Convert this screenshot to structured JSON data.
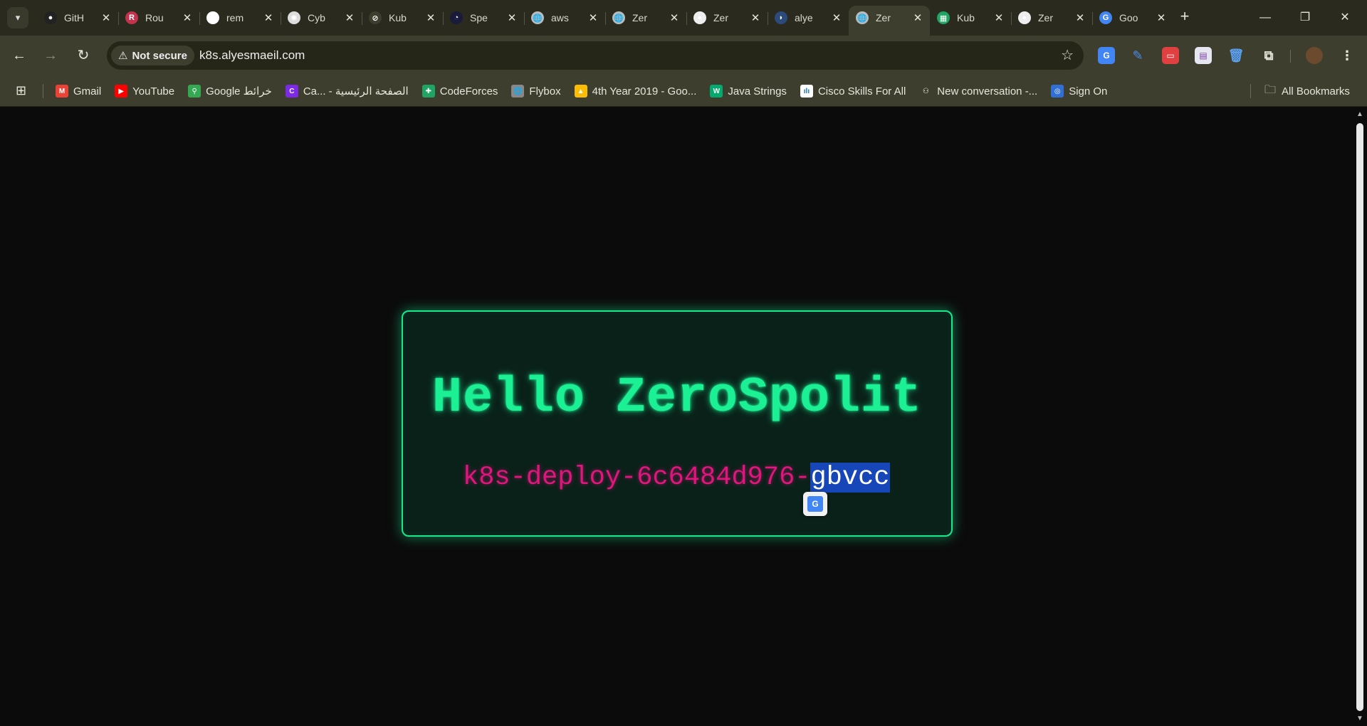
{
  "tabs": [
    {
      "title": "GitH",
      "favicon": "github-icon",
      "color": "#222222",
      "glyph": "●",
      "active": false
    },
    {
      "title": "Rou",
      "favicon": "router-icon",
      "color": "#c2334d",
      "glyph": "R",
      "active": false
    },
    {
      "title": "rem",
      "favicon": "google-icon",
      "color": "#ffffff",
      "glyph": "G",
      "active": false
    },
    {
      "title": "Cyb",
      "favicon": "openai-icon",
      "color": "#dddddd",
      "glyph": "✺",
      "active": false
    },
    {
      "title": "Kub",
      "favicon": "ban-icon",
      "color": "#3e3e2e",
      "glyph": "⊘",
      "active": false
    },
    {
      "title": "Spe",
      "favicon": "speed-icon",
      "color": "#1a1a3a",
      "glyph": "◔",
      "active": false
    },
    {
      "title": "aws",
      "favicon": "globe-icon",
      "color": "#bbbbbb",
      "glyph": "🌐",
      "active": false
    },
    {
      "title": "Zer",
      "favicon": "globe-icon",
      "color": "#bbbbbb",
      "glyph": "🌐",
      "active": false
    },
    {
      "title": "Zer",
      "favicon": "github-icon",
      "color": "#eeeeee",
      "glyph": "●",
      "active": false
    },
    {
      "title": "alye",
      "favicon": "bird-icon",
      "color": "#2c4a7a",
      "glyph": "◗",
      "active": false
    },
    {
      "title": "Zer",
      "favicon": "globe-icon",
      "color": "#bbbbbb",
      "glyph": "🌐",
      "active": true
    },
    {
      "title": "Kub",
      "favicon": "sheets-icon",
      "color": "#1fa463",
      "glyph": "▦",
      "active": false
    },
    {
      "title": "Zer",
      "favicon": "github-icon",
      "color": "#eeeeee",
      "glyph": "●",
      "active": false
    },
    {
      "title": "Goo",
      "favicon": "translate-icon",
      "color": "#4285f4",
      "glyph": "G",
      "active": false
    }
  ],
  "window": {
    "minimize": "—",
    "restore": "❐",
    "close": "✕",
    "new_tab": "+"
  },
  "address": {
    "security": "Not secure",
    "url": "k8s.alyesmaeil.com"
  },
  "bookmarks": [
    {
      "label": "Gmail",
      "favicon": "gmail-icon",
      "color": "#ea4335",
      "glyph": "M"
    },
    {
      "label": "YouTube",
      "favicon": "youtube-icon",
      "color": "#ff0000",
      "glyph": "▶"
    },
    {
      "label": "Google خرائط",
      "favicon": "maps-icon",
      "color": "#34a853",
      "glyph": "⚲"
    },
    {
      "label": "Ca... - الصفحة الرئيسية",
      "favicon": "canva-icon",
      "color": "#7d2ae8",
      "glyph": "C"
    },
    {
      "label": "CodeForces",
      "favicon": "sheets-icon",
      "color": "#1fa463",
      "glyph": "✚"
    },
    {
      "label": "Flybox",
      "favicon": "globe-icon",
      "color": "#888888",
      "glyph": "🌐"
    },
    {
      "label": "4th Year 2019 - Goo...",
      "favicon": "drive-icon",
      "color": "#fbbc04",
      "glyph": "▲"
    },
    {
      "label": "Java Strings",
      "favicon": "w3-icon",
      "color": "#04aa6d",
      "glyph": "W"
    },
    {
      "label": "Cisco Skills For All",
      "favicon": "cisco-icon",
      "color": "#ffffff",
      "glyph": "ılı"
    },
    {
      "label": "New conversation -...",
      "favicon": "copilot-icon",
      "color": "#3e3e2e",
      "glyph": "⚇"
    },
    {
      "label": "Sign On",
      "favicon": "fingerprint-icon",
      "color": "#2f6fd6",
      "glyph": "◎"
    }
  ],
  "all_bookmarks": "All Bookmarks",
  "page": {
    "heading": "Hello ZeroSpolit",
    "host_prefix": "k8s-deploy-6c6484d976-",
    "host_selected": "gbvcc"
  }
}
